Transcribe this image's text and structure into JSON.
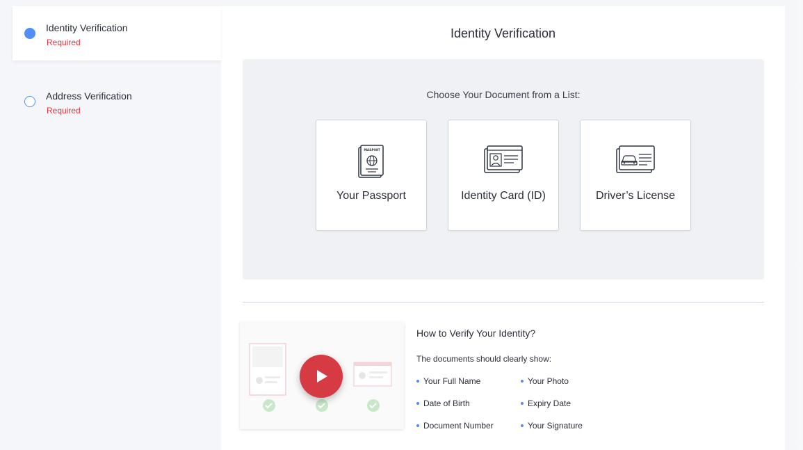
{
  "sidebar": {
    "steps": [
      {
        "title": "Identity Verification",
        "status": "Required",
        "state": "active"
      },
      {
        "title": "Address Verification",
        "status": "Required",
        "state": "inactive"
      }
    ]
  },
  "main": {
    "title": "Identity Verification",
    "doc_prompt": "Choose Your Document from a List:",
    "documents": [
      {
        "label": "Your Passport",
        "icon": "passport-icon"
      },
      {
        "label": "Identity Card (ID)",
        "icon": "id-card-icon"
      },
      {
        "label": "Driver’s License",
        "icon": "drivers-license-icon"
      }
    ],
    "howto": {
      "title": "How to Verify Your Identity?",
      "subtitle": "The documents should clearly show:",
      "items": [
        "Your Full Name",
        "Your Photo",
        "Date of Birth",
        "Expiry Date",
        "Document Number",
        "Your Signature"
      ]
    }
  },
  "colors": {
    "accent": "#4f8ff7",
    "required": "#e0333c",
    "play_button": "#d63a42",
    "panel": "#eff1f5"
  }
}
